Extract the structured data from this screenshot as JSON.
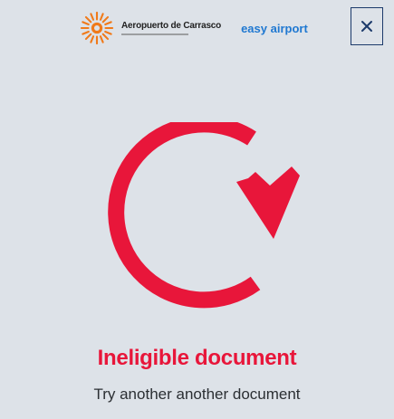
{
  "header": {
    "airport_logo_text": "Aeropuerto de Carrasco",
    "partner_logo_text": "easy airport",
    "close_icon": "close-icon"
  },
  "main": {
    "status_icon": "retry-icon",
    "title": "Ineligible document",
    "subtitle": "Try another another document"
  },
  "colors": {
    "background": "#dde2e8",
    "accent": "#e8163a",
    "close_border": "#1c3a6b",
    "partner_blue": "#1f78d1",
    "sun_orange": "#f07a1a"
  }
}
